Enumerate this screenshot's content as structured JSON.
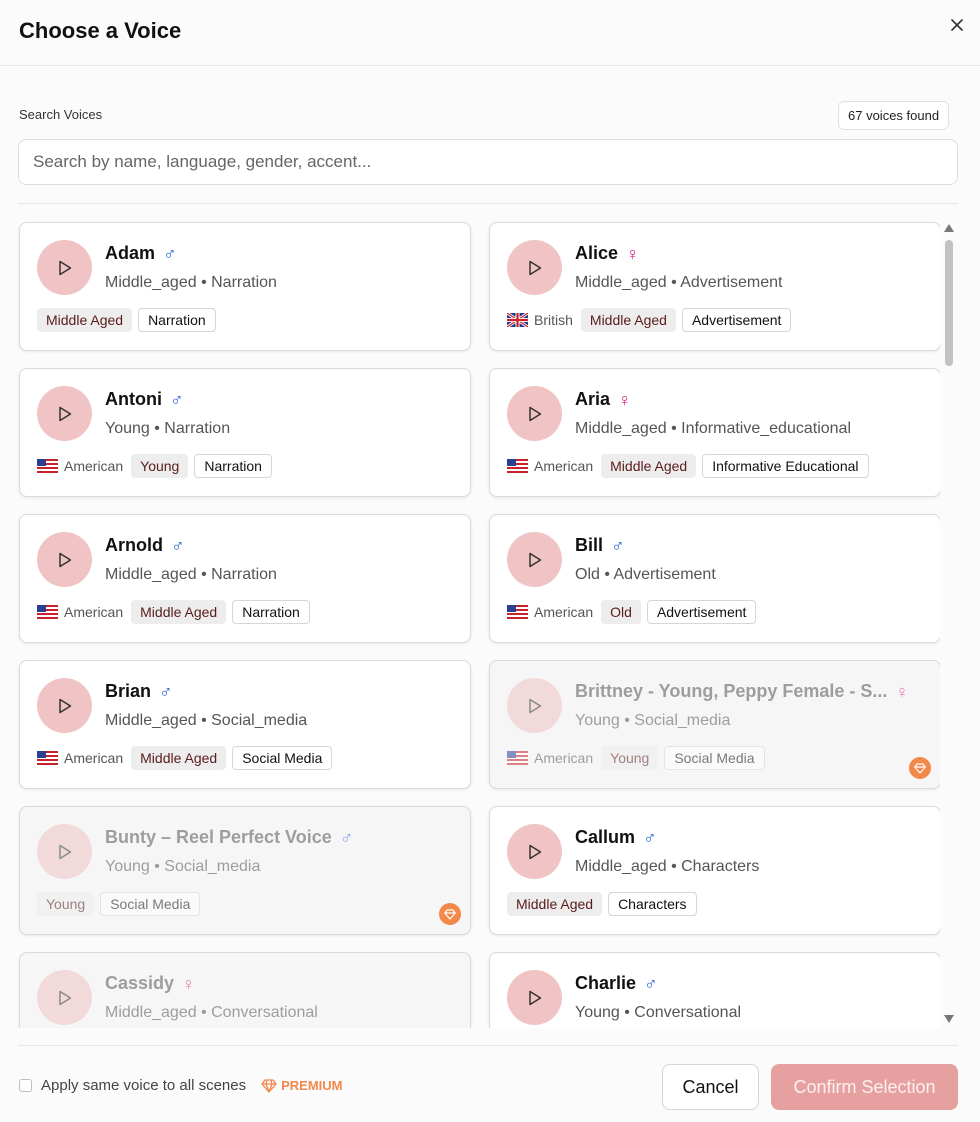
{
  "dialog": {
    "title": "Choose a Voice",
    "close_icon": "close-icon"
  },
  "search": {
    "label": "Search Voices",
    "found": "67 voices found",
    "placeholder": "Search by name, language, gender, accent...",
    "value": ""
  },
  "voices": [
    {
      "name": "Adam",
      "gender": "male",
      "sub": "Middle_aged • Narration",
      "accent": "",
      "flag": "",
      "age_tag": "Middle Aged",
      "category_tag": "Narration",
      "premium": false
    },
    {
      "name": "Alice",
      "gender": "female",
      "sub": "Middle_aged • Advertisement",
      "accent": "British",
      "flag": "uk-flag",
      "age_tag": "Middle Aged",
      "category_tag": "Advertisement",
      "premium": false
    },
    {
      "name": "Antoni",
      "gender": "male",
      "sub": "Young • Narration",
      "accent": "American",
      "flag": "us-flag",
      "age_tag": "Young",
      "category_tag": "Narration",
      "premium": false
    },
    {
      "name": "Aria",
      "gender": "female",
      "sub": "Middle_aged • Informative_educational",
      "accent": "American",
      "flag": "us-flag",
      "age_tag": "Middle Aged",
      "category_tag": "Informative Educational",
      "premium": false
    },
    {
      "name": "Arnold",
      "gender": "male",
      "sub": "Middle_aged • Narration",
      "accent": "American",
      "flag": "us-flag",
      "age_tag": "Middle Aged",
      "category_tag": "Narration",
      "premium": false
    },
    {
      "name": "Bill",
      "gender": "male",
      "sub": "Old • Advertisement",
      "accent": "American",
      "flag": "us-flag",
      "age_tag": "Old",
      "category_tag": "Advertisement",
      "premium": false
    },
    {
      "name": "Brian",
      "gender": "male",
      "sub": "Middle_aged • Social_media",
      "accent": "American",
      "flag": "us-flag",
      "age_tag": "Middle Aged",
      "category_tag": "Social Media",
      "premium": false
    },
    {
      "name": "Brittney - Young, Peppy Female - S...",
      "gender": "female",
      "sub": "Young • Social_media",
      "accent": "American",
      "flag": "us-flag",
      "age_tag": "Young",
      "category_tag": "Social Media",
      "premium": true
    },
    {
      "name": "Bunty – Reel Perfect Voice",
      "gender": "male",
      "sub": "Young • Social_media",
      "accent": "",
      "flag": "",
      "age_tag": "Young",
      "category_tag": "Social Media",
      "premium": true
    },
    {
      "name": "Callum",
      "gender": "male",
      "sub": "Middle_aged • Characters",
      "accent": "",
      "flag": "",
      "age_tag": "Middle Aged",
      "category_tag": "Characters",
      "premium": false
    },
    {
      "name": "Cassidy",
      "gender": "female",
      "sub": "Middle_aged • Conversational",
      "accent": "",
      "flag": "",
      "age_tag": "",
      "category_tag": "",
      "premium": true
    },
    {
      "name": "Charlie",
      "gender": "male",
      "sub": "Young • Conversational",
      "accent": "",
      "flag": "",
      "age_tag": "",
      "category_tag": "",
      "premium": false
    }
  ],
  "footer": {
    "apply_label": "Apply same voice to all scenes",
    "premium_label": "PREMIUM",
    "cancel_label": "Cancel",
    "confirm_label": "Confirm Selection"
  },
  "colors": {
    "accent": "#e7a0a0",
    "play_bg": "#f0c4c4",
    "male": "#2b63d9",
    "female": "#d91f8a",
    "premium": "#f2884a"
  }
}
